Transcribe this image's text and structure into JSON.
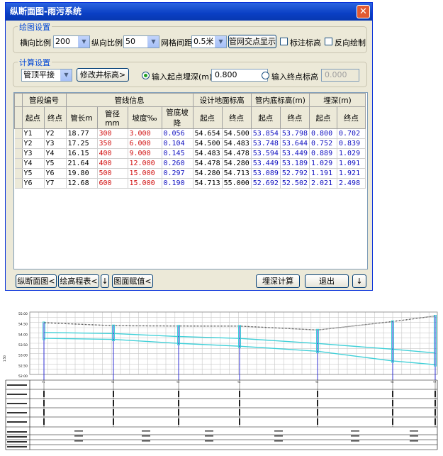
{
  "window": {
    "title": "纵断面图-雨污系统"
  },
  "drawing": {
    "group_title": "绘图设置",
    "hscale_label": "横向比例",
    "hscale_value": "200",
    "vscale_label": "纵向比例",
    "vscale_value": "50",
    "grid_label": "网格间距",
    "grid_value": "0.5米",
    "grid_points_button": "管网交点显示",
    "label_elev_checkbox": "标注标高",
    "reverse_checkbox": "反向绘制"
  },
  "calc": {
    "group_title": "计算设置",
    "mode_value": "管顶平接",
    "edit_well_button": "修改井标高>",
    "start_radio": "输入起点埋深(m)",
    "start_value": "0.800",
    "end_radio": "输入终点标高",
    "end_value": "0.000"
  },
  "table": {
    "groups": [
      "管段编号",
      "管线信息",
      "设计地面标高",
      "管内底标高(m)",
      "埋深(m)"
    ],
    "columns": [
      "起点",
      "终点",
      "管长m",
      "管径mm",
      "坡度‰",
      "管底坡降",
      "起点",
      "终点",
      "起点",
      "终点",
      "起点",
      "终点"
    ],
    "rows": [
      [
        "Y1",
        "Y2",
        "18.77",
        "300",
        "3.000",
        "0.056",
        "54.654",
        "54.500",
        "53.854",
        "53.798",
        "0.800",
        "0.702"
      ],
      [
        "Y2",
        "Y3",
        "17.25",
        "350",
        "6.000",
        "0.104",
        "54.500",
        "54.483",
        "53.748",
        "53.644",
        "0.752",
        "0.839"
      ],
      [
        "Y3",
        "Y4",
        "16.15",
        "400",
        "9.000",
        "0.145",
        "54.483",
        "54.478",
        "53.594",
        "53.449",
        "0.889",
        "1.029"
      ],
      [
        "Y4",
        "Y5",
        "21.64",
        "400",
        "12.000",
        "0.260",
        "54.478",
        "54.280",
        "53.449",
        "53.189",
        "1.029",
        "1.091"
      ],
      [
        "Y5",
        "Y6",
        "19.80",
        "500",
        "15.000",
        "0.297",
        "54.280",
        "54.713",
        "53.089",
        "52.792",
        "1.191",
        "1.921"
      ],
      [
        "Y6",
        "Y7",
        "12.68",
        "600",
        "15.000",
        "0.190",
        "54.713",
        "55.000",
        "52.692",
        "52.502",
        "2.021",
        "2.498"
      ]
    ]
  },
  "footer": {
    "profile_button": "纵断面图<",
    "elev_table_button": "绘高程表<",
    "down_button": "↓",
    "assign_button": "图面赋值<",
    "calc_button": "埋深计算",
    "exit_button": "退出",
    "down2_button": "↓"
  },
  "profile": {
    "y_ticks": [
      "55.00",
      "54.50",
      "54.00",
      "53.50",
      "53.00",
      "52.50",
      "52.00"
    ],
    "scale_label": "1:50",
    "nodes": [
      "Y1",
      "Y2",
      "Y3",
      "Y4",
      "Y5",
      "Y6",
      "Y7"
    ]
  },
  "colors": {
    "cyan": "#40d0d8",
    "blue": "#1a1ad0",
    "red": "#d01010",
    "title_bar": "#0a3fc4"
  }
}
